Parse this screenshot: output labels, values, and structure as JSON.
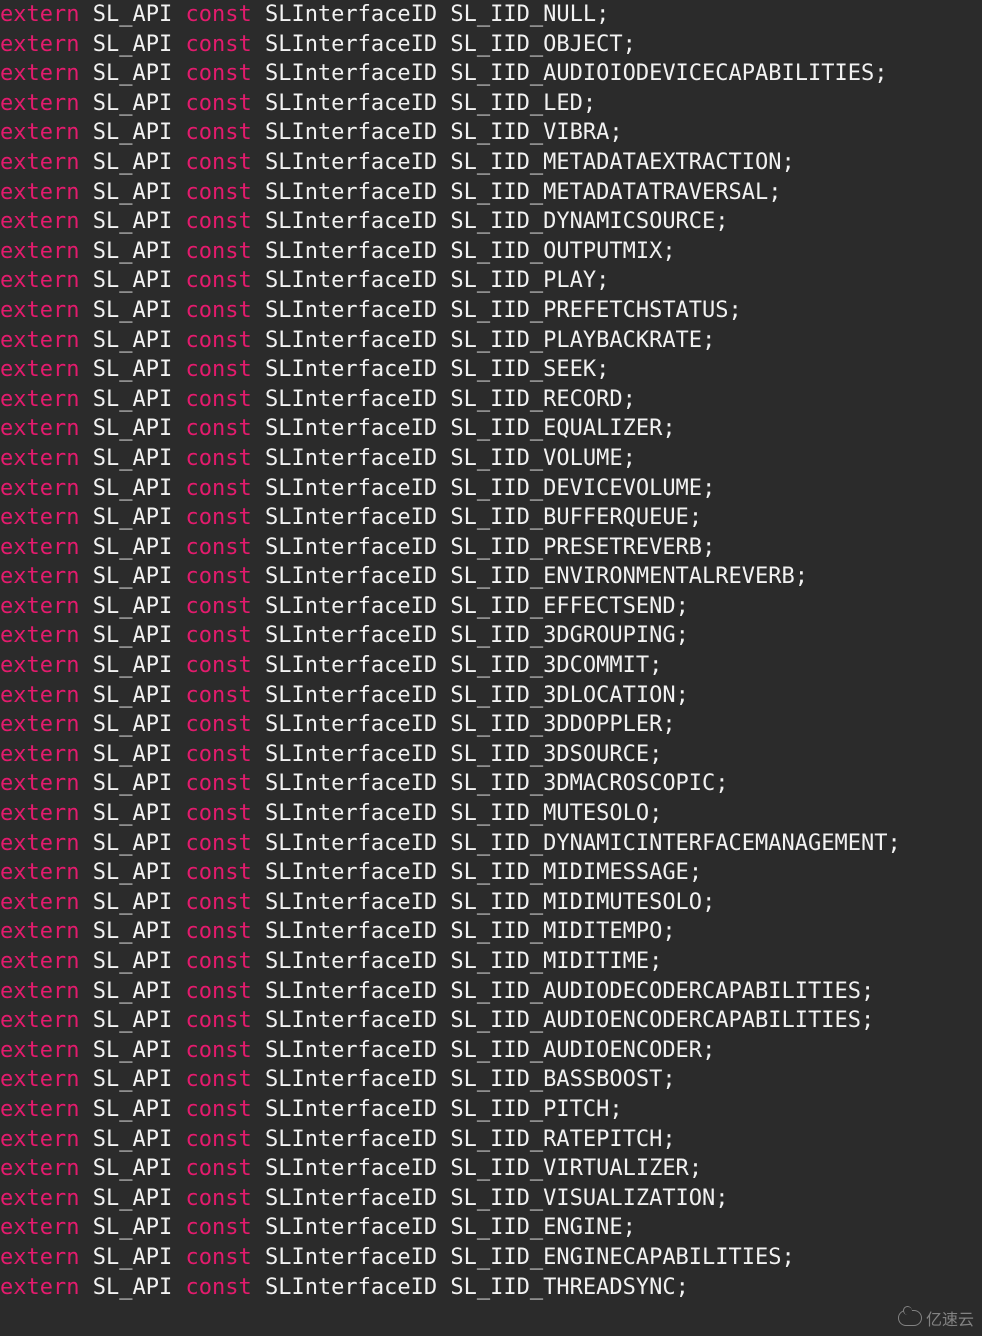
{
  "code": {
    "extern": "extern",
    "api": "SL_API",
    "const": "const",
    "type": "SLInterfaceID",
    "lines": [
      "SL_IID_NULL",
      "SL_IID_OBJECT",
      "SL_IID_AUDIOIODEVICECAPABILITIES",
      "SL_IID_LED",
      "SL_IID_VIBRA",
      "SL_IID_METADATAEXTRACTION",
      "SL_IID_METADATATRAVERSAL",
      "SL_IID_DYNAMICSOURCE",
      "SL_IID_OUTPUTMIX",
      "SL_IID_PLAY",
      "SL_IID_PREFETCHSTATUS",
      "SL_IID_PLAYBACKRATE",
      "SL_IID_SEEK",
      "SL_IID_RECORD",
      "SL_IID_EQUALIZER",
      "SL_IID_VOLUME",
      "SL_IID_DEVICEVOLUME",
      "SL_IID_BUFFERQUEUE",
      "SL_IID_PRESETREVERB",
      "SL_IID_ENVIRONMENTALREVERB",
      "SL_IID_EFFECTSEND",
      "SL_IID_3DGROUPING",
      "SL_IID_3DCOMMIT",
      "SL_IID_3DLOCATION",
      "SL_IID_3DDOPPLER",
      "SL_IID_3DSOURCE",
      "SL_IID_3DMACROSCOPIC",
      "SL_IID_MUTESOLO",
      "SL_IID_DYNAMICINTERFACEMANAGEMENT",
      "SL_IID_MIDIMESSAGE",
      "SL_IID_MIDIMUTESOLO",
      "SL_IID_MIDITEMPO",
      "SL_IID_MIDITIME",
      "SL_IID_AUDIODECODERCAPABILITIES",
      "SL_IID_AUDIOENCODERCAPABILITIES",
      "SL_IID_AUDIOENCODER",
      "SL_IID_BASSBOOST",
      "SL_IID_PITCH",
      "SL_IID_RATEPITCH",
      "SL_IID_VIRTUALIZER",
      "SL_IID_VISUALIZATION",
      "SL_IID_ENGINE",
      "SL_IID_ENGINECAPABILITIES",
      "SL_IID_THREADSYNC"
    ],
    "semicolon": ";"
  },
  "watermark": {
    "text": "亿速云"
  }
}
